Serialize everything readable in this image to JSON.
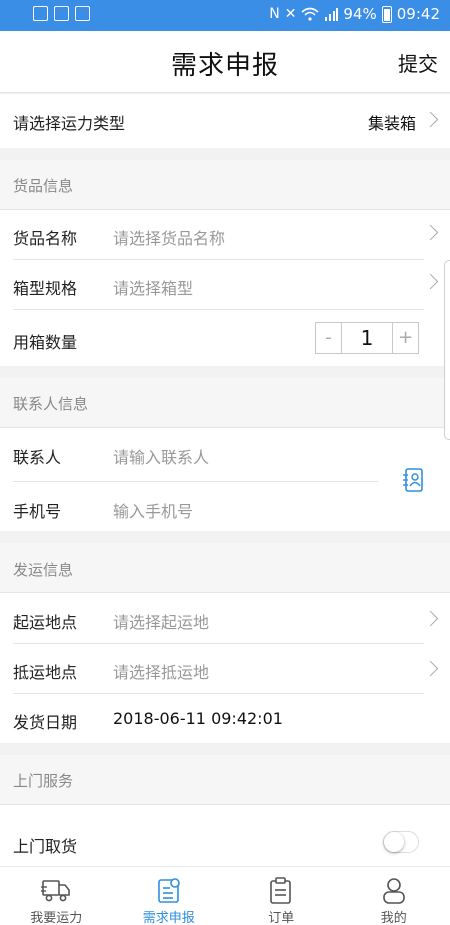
{
  "status_bar": {
    "battery": "94%",
    "time": "09:42"
  },
  "header": {
    "title": "需求申报",
    "submit_label": "提交"
  },
  "capacity_type": {
    "label": "请选择运力类型",
    "value": "集装箱"
  },
  "goods": {
    "section_title": "货品信息",
    "name": {
      "label": "货品名称",
      "placeholder": "请选择货品名称"
    },
    "box_spec": {
      "label": "箱型规格",
      "placeholder": "请选择箱型"
    },
    "box_count": {
      "label": "用箱数量",
      "minus": "-",
      "value": "1",
      "plus": "+"
    }
  },
  "contact": {
    "section_title": "联系人信息",
    "person": {
      "label": "联系人",
      "placeholder": "请输入联系人"
    },
    "phone": {
      "label": "手机号",
      "placeholder": "输入手机号"
    }
  },
  "shipping": {
    "section_title": "发运信息",
    "origin": {
      "label": "起运地点",
      "placeholder": "请选择起运地"
    },
    "destination": {
      "label": "抵运地点",
      "placeholder": "请选择抵运地"
    },
    "ship_date": {
      "label": "发货日期",
      "value": "2018-06-11 09:42:01"
    }
  },
  "door_service": {
    "section_title": "上门服务",
    "pickup": {
      "label": "上门取货",
      "on": false
    }
  },
  "tabs": [
    {
      "label": "我要运力",
      "icon": "truck-icon",
      "active": false
    },
    {
      "label": "需求申报",
      "icon": "form-icon",
      "active": true
    },
    {
      "label": "订单",
      "icon": "clipboard-icon",
      "active": false
    },
    {
      "label": "我的",
      "icon": "user-icon",
      "active": false
    }
  ],
  "colors": {
    "status_bar": "#3a8ee6",
    "accent": "#2e8fe0"
  }
}
